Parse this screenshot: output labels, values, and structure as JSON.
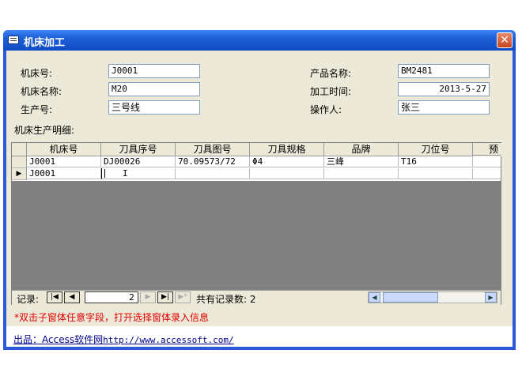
{
  "window": {
    "title": "机床加工",
    "close": "✕"
  },
  "form": {
    "machine_no": {
      "label": "机床号:",
      "value": "J0001"
    },
    "machine_name": {
      "label": "机床名称:",
      "value": "M20"
    },
    "production_no": {
      "label": "生产号:",
      "value": "三号线"
    },
    "product_name": {
      "label": "产品名称:",
      "value": "BM2481"
    },
    "process_time": {
      "label": "加工时间:",
      "value": "2013-5-27"
    },
    "operator": {
      "label": "操作人:",
      "value": "张三"
    },
    "detail_label": "机床生产明细:"
  },
  "grid": {
    "columns": [
      "机床号",
      "刀具序号",
      "刀具图号",
      "刀具规格",
      "品牌",
      "刀位号",
      "预"
    ],
    "rows": [
      [
        "J0001",
        "DJ00026",
        "70.09573/72",
        "Φ4",
        "三峰",
        "T16",
        ""
      ],
      [
        "J0001",
        "",
        "",
        "",
        "",
        "",
        ""
      ]
    ],
    "current_row_marker": "▶"
  },
  "navigator": {
    "record_label": "记录:",
    "first": "|◀",
    "prev": "◀",
    "current": "2",
    "next": "▶",
    "last": "▶|",
    "new": "▶*",
    "total_label": "共有记录数: 2",
    "scroll_left": "◀",
    "scroll_right": "▶"
  },
  "note": "*双击子窗体任意字段，打开选择窗体录入信息",
  "footer": {
    "prefix": "出品：Access软件网",
    "url": "http://www.accessoft.com/"
  }
}
